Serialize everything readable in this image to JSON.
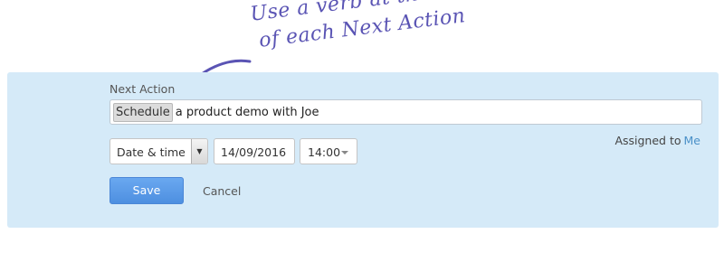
{
  "annotation": {
    "line1": "Use a verb at the start",
    "line2": "of each Next Action"
  },
  "form": {
    "field_label": "Next Action",
    "action_verb": "Schedule",
    "action_rest": "a product demo with Joe",
    "due_type": "Date & time",
    "date": "14/09/2016",
    "time": "14:00",
    "assigned_label": "Assigned to",
    "assigned_value": "Me",
    "save_label": "Save",
    "cancel_label": "Cancel"
  },
  "colors": {
    "panel_bg": "#d5eaf8",
    "accent": "#4d8fe0",
    "annotation": "#5a54b4",
    "link": "#4a90c8"
  }
}
